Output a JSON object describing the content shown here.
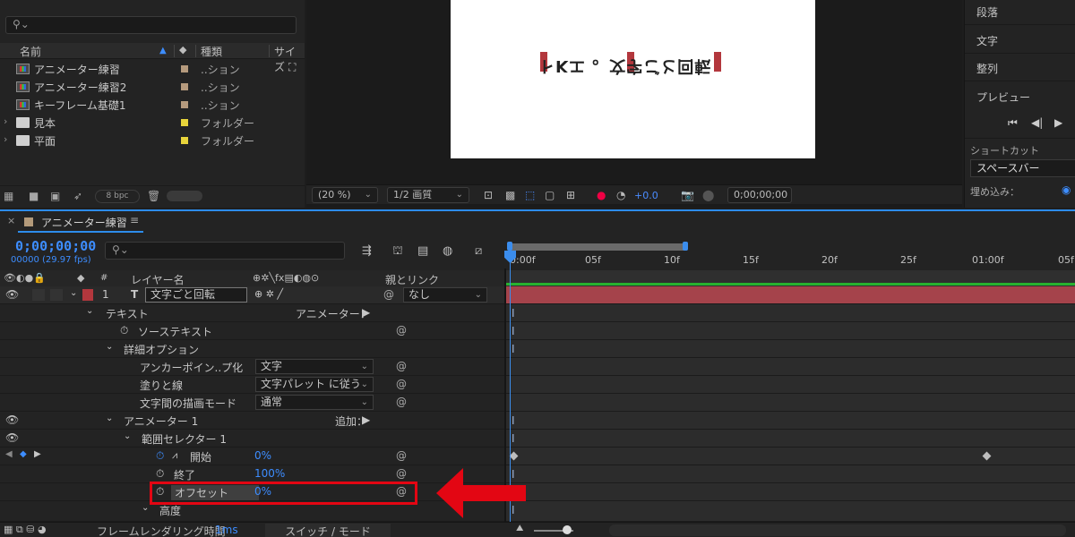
{
  "project": {
    "search_icon": "search-icon",
    "columns": [
      "名前",
      "種類",
      "サイズ"
    ],
    "items": [
      {
        "name": "アニメーター練習",
        "type": "..ション",
        "icon": "composition-icon",
        "label_color": "#b59a7d"
      },
      {
        "name": "アニメーター練習2",
        "type": "..ション",
        "icon": "composition-icon",
        "label_color": "#b59a7d"
      },
      {
        "name": "キーフレーム基礎1",
        "type": "..ション",
        "icon": "composition-icon",
        "label_color": "#b59a7d"
      },
      {
        "name": "見本",
        "type": "フォルダー",
        "icon": "folder-icon",
        "label_color": "#e8d43b"
      },
      {
        "name": "平面",
        "type": "フォルダー",
        "icon": "folder-icon",
        "label_color": "#e8d43b"
      }
    ],
    "bpc": "8 bpc"
  },
  "viewer": {
    "canvas_text": "トKエ 。文字ごと回転",
    "zoom": "(20 %)",
    "resolution": "1/2 画質",
    "exposure": "+0.0",
    "timecode": "0;00;00;00"
  },
  "right_panel": {
    "items": [
      "段落",
      "文字",
      "整列",
      "プレビュー"
    ],
    "shortcut_label": "ショートカット",
    "shortcut_value": "スペースバー",
    "embed_label": "埋め込み："
  },
  "timeline": {
    "tab_title": "アニメーター練習",
    "timecode": "0;00;00;00",
    "timecode_sub": "00000 (29.97 fps)",
    "col_layer_name": "レイヤー名",
    "col_parent": "親とリンク",
    "col_num": "#",
    "ruler_ticks": [
      "0:00f",
      "05f",
      "10f",
      "15f",
      "20f",
      "25f",
      "01:00f",
      "05f"
    ],
    "layer": {
      "index": "1",
      "name": "文字ごと回転",
      "parent": "なし"
    },
    "rows": {
      "text": "テキスト",
      "animator_menu": "アニメーター：",
      "source_text": "ソーステキスト",
      "more_options": "詳細オプション",
      "anchor_group": "アンカーポイン..プ化",
      "anchor_group_value": "文字",
      "fill_stroke": "塗りと線",
      "fill_stroke_value": "文字パレット に従う",
      "blend": "文字間の描画モード",
      "blend_value": "通常",
      "animator1": "アニメーター 1",
      "add": "追加：",
      "range_selector": "範囲セレクター 1",
      "start": "開始",
      "start_value": "0%",
      "end": "終了",
      "end_value": "100%",
      "offset": "オフセット",
      "offset_value": "0%",
      "advanced": "高度"
    },
    "status_label": "フレームレンダリング時間",
    "status_value": "1ms",
    "switch_mode": "スイッチ / モード"
  },
  "colors": {
    "accent": "#3d8dff",
    "highlight": "#e30613",
    "layer_bar": "#a5434b"
  }
}
